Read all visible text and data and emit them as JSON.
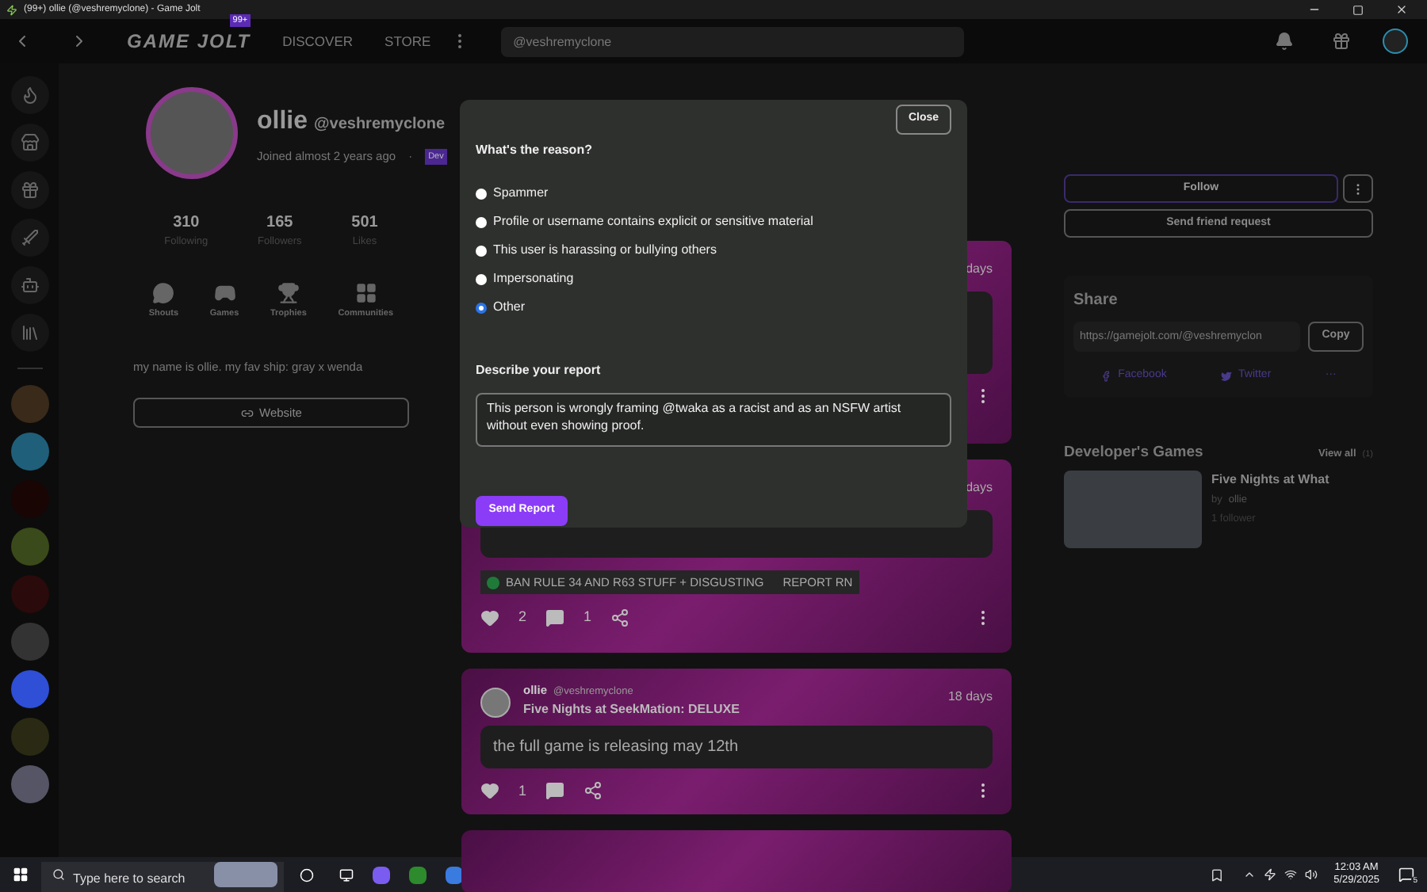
{
  "window": {
    "title": "(99+) ollie (@veshremyclone) - Game Jolt"
  },
  "nav": {
    "badge": "99+",
    "logo": "GAME JOLT",
    "links": [
      "DISCOVER",
      "STORE"
    ],
    "search": {
      "value": "@veshremyclone"
    }
  },
  "profile": {
    "name": "ollie",
    "handle": "@veshremyclone",
    "joined": "Joined almost 2 years ago",
    "separator": "·",
    "tag": "Dev",
    "stats": [
      {
        "value": "310",
        "label": "Following"
      },
      {
        "value": "165",
        "label": "Followers"
      },
      {
        "value": "501",
        "label": "Likes"
      }
    ],
    "tabs": [
      {
        "label": "Shouts",
        "kind": "shouts"
      },
      {
        "label": "Games",
        "kind": "games"
      },
      {
        "label": "Trophies",
        "kind": "trophies"
      },
      {
        "label": "Communities",
        "kind": "communities"
      }
    ],
    "bio": "my name is ollie. my fav ship: gray x wenda",
    "website": "Website"
  },
  "feed": [
    {
      "time": "days",
      "kind": "covered"
    },
    {
      "time": "days",
      "kind": "tagged",
      "tags": [
        {
          "label": "BAN RULE 34 AND R63 STUFF + DISGUSTING",
          "color": "#1f7a3a"
        },
        {
          "label": "REPORT RN"
        }
      ],
      "likes": "2",
      "comments": "1"
    },
    {
      "time": "18 days",
      "kind": "full",
      "author": "ollie",
      "handle": "@veshremyclone",
      "game": "Five Nights at SeekMation: DELUXE",
      "text": "the full game is releasing may 12th",
      "likes": "1"
    },
    {
      "kind": "partial"
    }
  ],
  "aside": {
    "follow": "Follow",
    "friend": "Send friend request",
    "share": {
      "title": "Share",
      "url": "https://gamejolt.com/@veshremyclon",
      "copy": "Copy",
      "links": [
        "Facebook",
        "Twitter",
        "···"
      ]
    },
    "games": {
      "title": "Developer's Games",
      "view_all": "View all",
      "count": "(1)",
      "items": [
        {
          "title": "Five Nights at What",
          "by": "by",
          "author": "ollie",
          "followers": "1 follower"
        }
      ]
    }
  },
  "modal": {
    "close": "Close",
    "question": "What's the reason?",
    "reasons": [
      {
        "label": "Spammer",
        "selected": false
      },
      {
        "label": "Profile or username contains explicit or sensitive material",
        "selected": false
      },
      {
        "label": "This user is harassing or bullying others",
        "selected": false
      },
      {
        "label": "Impersonating",
        "selected": false
      },
      {
        "label": "Other",
        "selected": true
      }
    ],
    "describe": "Describe your report",
    "report": "This person is wrongly framing @twaka as a racist and as an NSFW artist without even showing proof.",
    "submit": "Send Report"
  },
  "taskbar": {
    "search": {
      "placeholder": "Type here to search"
    },
    "time": "12:03 AM",
    "date": "5/29/2025",
    "notifications": "5"
  }
}
